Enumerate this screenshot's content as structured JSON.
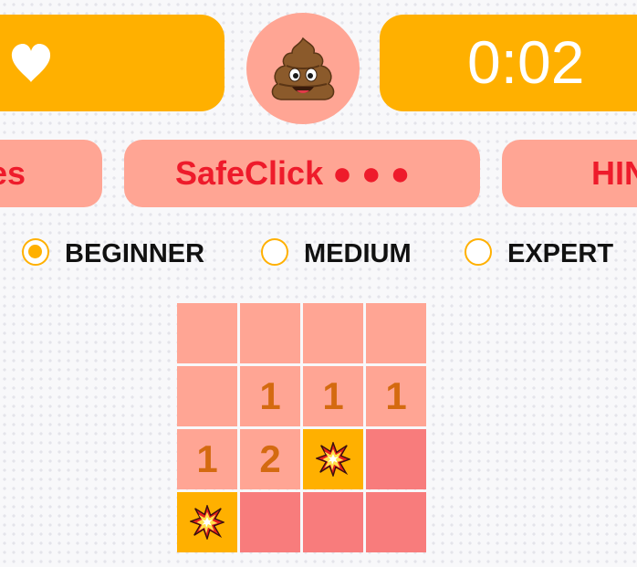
{
  "header": {
    "lives_icon": "heart-icon",
    "face_icon": "poop-emoji-icon",
    "timer": "0:02"
  },
  "actions": {
    "lives_label": "es",
    "safeclick_label": "SafeClick",
    "safeclick_remaining": 3,
    "hint_label": "HIN"
  },
  "difficulty": {
    "options": [
      {
        "label": "BEGINNER",
        "checked": true
      },
      {
        "label": "MEDIUM",
        "checked": false
      },
      {
        "label": "EXPERT",
        "checked": false
      }
    ]
  },
  "board": {
    "rows": [
      [
        {
          "state": "revealed",
          "text": ""
        },
        {
          "state": "revealed",
          "text": ""
        },
        {
          "state": "revealed",
          "text": ""
        },
        {
          "state": "revealed",
          "text": ""
        }
      ],
      [
        {
          "state": "revealed",
          "text": ""
        },
        {
          "state": "revealed",
          "text": "1"
        },
        {
          "state": "revealed",
          "text": "1"
        },
        {
          "state": "revealed",
          "text": "1"
        }
      ],
      [
        {
          "state": "revealed",
          "text": "1"
        },
        {
          "state": "revealed",
          "text": "2"
        },
        {
          "state": "mine",
          "text": ""
        },
        {
          "state": "hidden",
          "text": ""
        }
      ],
      [
        {
          "state": "mine",
          "text": ""
        },
        {
          "state": "hidden",
          "text": ""
        },
        {
          "state": "hidden",
          "text": ""
        },
        {
          "state": "hidden",
          "text": ""
        }
      ]
    ]
  },
  "colors": {
    "amber": "#ffb000",
    "salmon": "#ffa594",
    "hidden_cell": "#f87c7c",
    "red_text": "#ee1b2b",
    "number": "#d46a10"
  }
}
